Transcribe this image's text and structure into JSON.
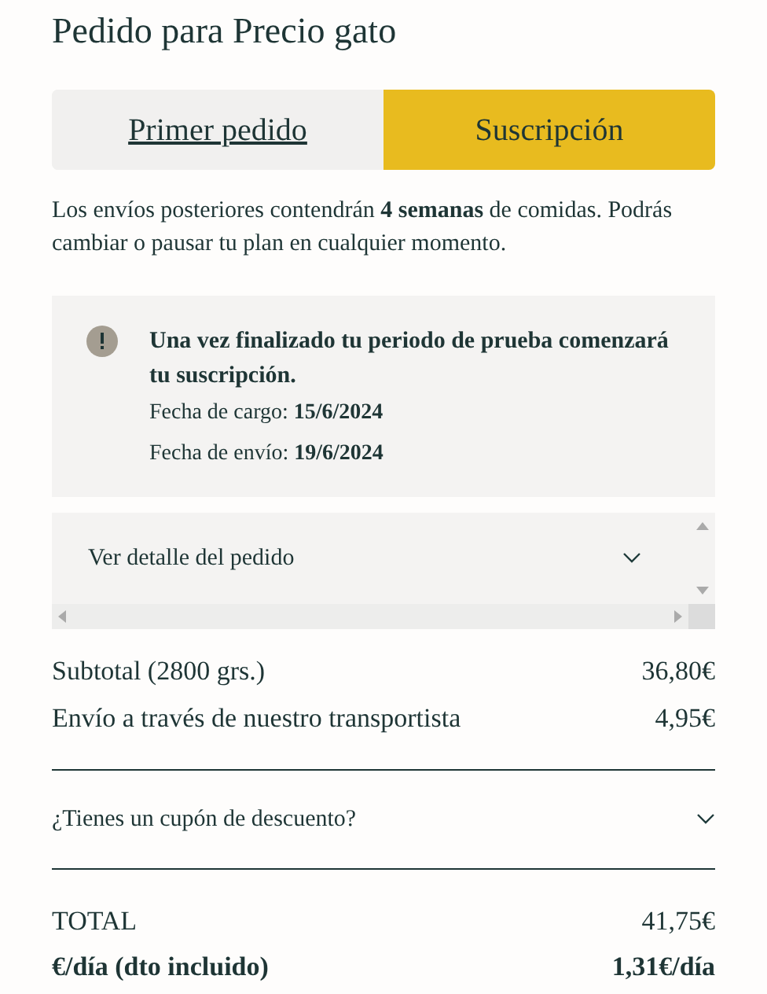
{
  "title": "Pedido para Precio gato",
  "tabs": [
    {
      "label": "Primer pedido",
      "selected": false
    },
    {
      "label": "Suscripción",
      "selected": true
    }
  ],
  "description": "Los envíos posteriores contendrán **4 semanas** de comidas. Podrás cambiar o pausar tu plan en cualquier momento.",
  "notice": {
    "heading": "Una vez finalizado tu periodo de prueba comenzará tu suscripción.",
    "lines": [
      "Fecha de cargo: **15/6/2024**",
      "Fecha de envío: **19/6/2024**"
    ]
  },
  "order_detail": {
    "label": "Ver detalle del pedido",
    "expanded": false
  },
  "summary": [
    {
      "label": "Subtotal (2800 grs.)",
      "value": "36,80€"
    },
    {
      "label": "Envío a través de nuestro transportista",
      "value": "4,95€"
    }
  ],
  "coupon": {
    "label": "¿Tienes un cupón de descuento?",
    "expanded": false
  },
  "totals": [
    {
      "label": "TOTAL",
      "value": "41,75€",
      "bold": false
    },
    {
      "label": "€/día (dto incluido)",
      "value": "1,31€/día",
      "bold": true
    }
  ]
}
